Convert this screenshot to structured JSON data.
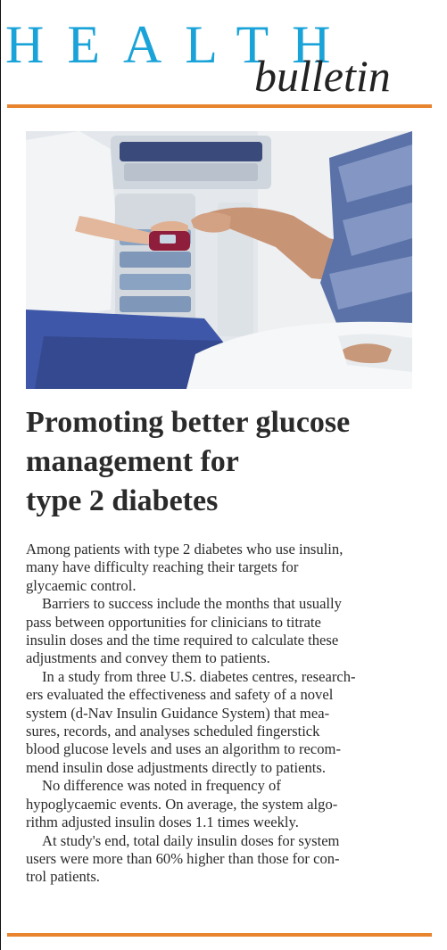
{
  "masthead": {
    "word1": "HEALTH",
    "word2": "bulletin"
  },
  "colors": {
    "masthead_blue": "#1aa3d8",
    "rule_orange": "#e8832e",
    "text": "#2b2b2b"
  },
  "photo": {
    "icon": "clinician-testing-patient-glucose-photo"
  },
  "headline": {
    "lines": [
      "Promoting better glucose",
      "management for",
      "type 2 diabetes"
    ]
  },
  "article": {
    "lines": [
      "Among patients with type 2 diabetes who use insulin,",
      "many have difficulty reaching their targets for",
      "glycaemic control.",
      "Barriers to success include the months that usually",
      "pass between opportunities for clinicians to titrate",
      "insulin doses and the time required to calculate these",
      "adjustments and convey them to patients.",
      "In a study from three U.S. diabetes centres, research-",
      "ers evaluated the effectiveness and safety of a novel",
      "system (d-Nav Insulin Guidance System) that mea-",
      "sures, records, and analyses scheduled fingerstick",
      "blood glucose levels and uses an algorithm to recom-",
      "mend insulin dose adjustments directly to patients.",
      "No difference was noted in frequency of",
      "hypoglycaemic events. On average, the system algo-",
      "rithm adjusted insulin doses 1.1 times weekly.",
      "At study's end, total daily insulin doses for system",
      "users were more than 60% higher than those for con-",
      "trol patients."
    ]
  }
}
